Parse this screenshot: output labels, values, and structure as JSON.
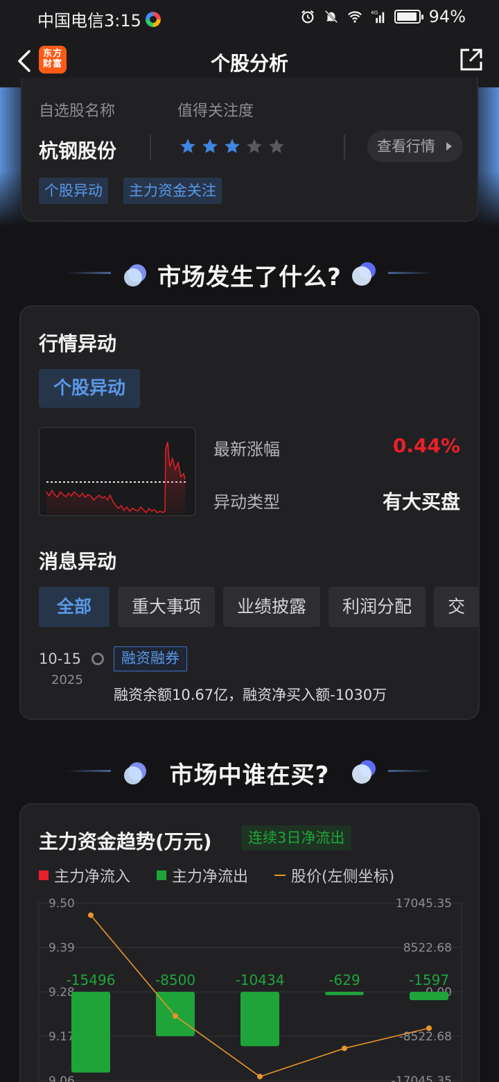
{
  "status_bar": {
    "carrier_time": "中国电信3:15",
    "battery": "94%",
    "network": "4G"
  },
  "nav": {
    "logo_text": "东方财富",
    "title": "个股分析"
  },
  "stock_card": {
    "name_label": "自选股名称",
    "attention_label": "值得关注度",
    "stock_name": "杭钢股份",
    "stars": 3,
    "stars_total": 5,
    "view_button": "查看行情",
    "tags": [
      "个股异动",
      "主力资金关注"
    ]
  },
  "section1": {
    "title": "市场发生了什么?"
  },
  "market": {
    "heading": "行情异动",
    "tag": "个股异动",
    "latest_change_label": "最新涨幅",
    "latest_change_value": "0.44%",
    "type_label": "异动类型",
    "type_value": "有大买盘",
    "news_heading": "消息异动",
    "news_tabs": [
      "全部",
      "重大事项",
      "业绩披露",
      "利润分配",
      "交"
    ],
    "active_tab": "全部",
    "news_date": "10-15",
    "news_year": "2025",
    "news_tag": "融资融券",
    "news_text": "融资余额10.67亿，融资净买入额-1030万"
  },
  "section2": {
    "title": "市场中谁在买?"
  },
  "fund": {
    "heading": "主力资金趋势(万元)",
    "trend_tag": "连续3日净流出",
    "legend": [
      "主力净流入",
      "主力净流出",
      "股价(左侧坐标)"
    ],
    "colors": {
      "inflow": "#e8202a",
      "outflow": "#1fa43a",
      "price": "#e8952c"
    }
  },
  "chart_data": {
    "type": "bar",
    "title": "主力资金趋势(万元)",
    "legend_position": "top-left",
    "series": [
      {
        "name": "主力净流出",
        "values": [
          -15496,
          -8500,
          -10434,
          -629,
          -1597
        ]
      },
      {
        "name": "股价(左侧坐标)",
        "values": [
          9.47,
          9.22,
          9.07,
          9.14,
          9.19
        ]
      }
    ],
    "y_left_ticks": [
      "9.50",
      "9.39",
      "9.28",
      "9.17",
      "9.06"
    ],
    "y_right_ticks": [
      "17045.35",
      "8522.68",
      "0.00",
      "-8522.68",
      "-17045.35"
    ],
    "ylim_right": [
      -17045.35,
      17045.35
    ],
    "ylim_left": [
      9.06,
      9.5
    ],
    "grid": true
  }
}
